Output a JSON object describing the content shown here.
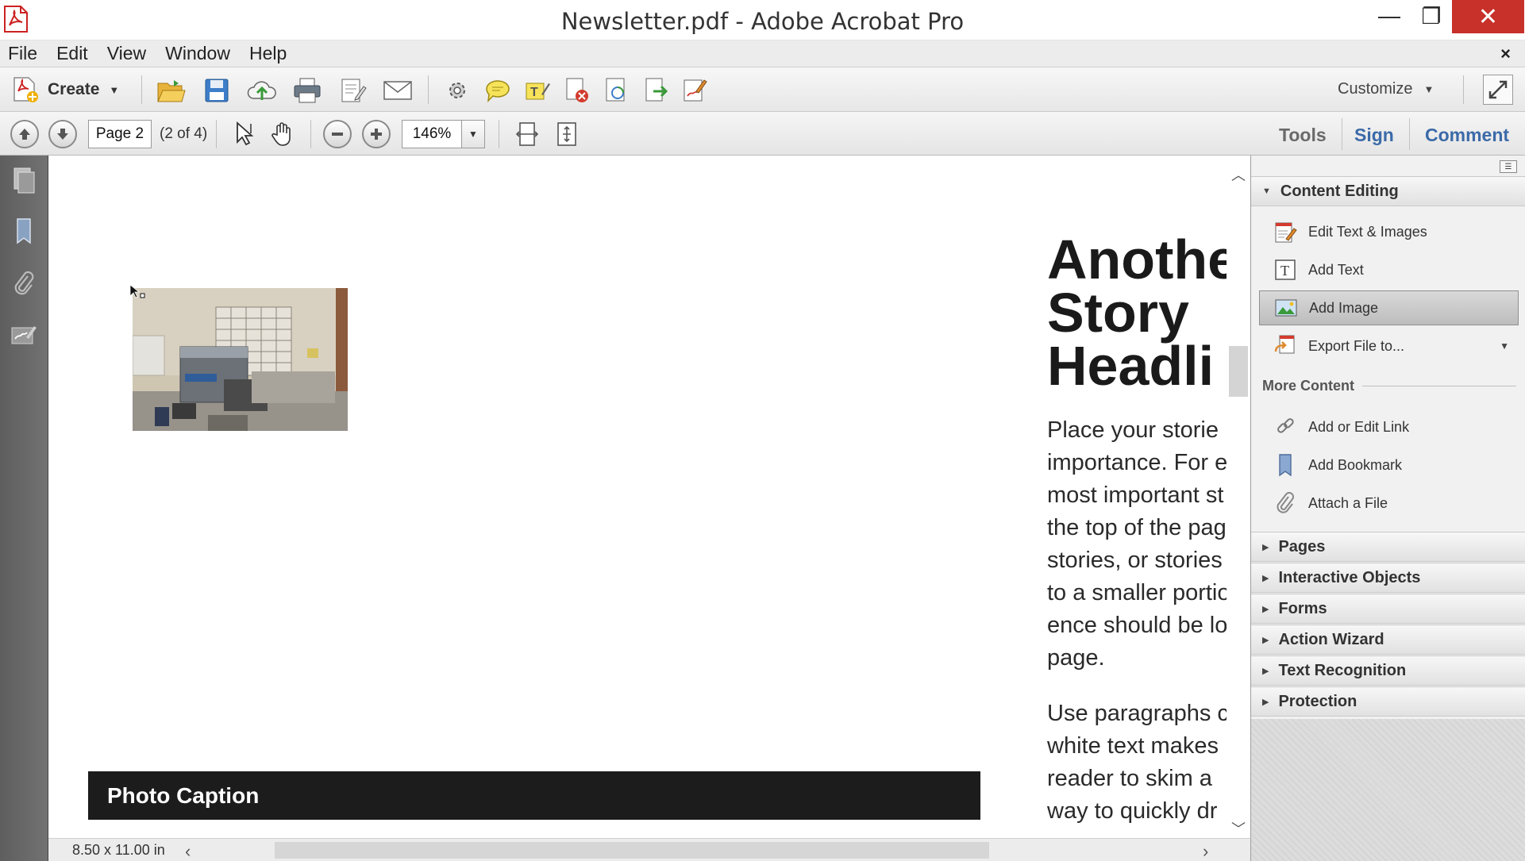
{
  "window": {
    "title": "Newsletter.pdf - Adobe Acrobat Pro",
    "minimize_glyph": "—",
    "maximize_glyph": "❐",
    "close_glyph": "✕"
  },
  "menu": {
    "items": [
      "File",
      "Edit",
      "View",
      "Window",
      "Help"
    ],
    "close_glyph": "×"
  },
  "toolbar": {
    "create_label": "Create",
    "customize_label": "Customize",
    "icons": [
      "open-folder-icon",
      "save-icon",
      "upload-cloud-icon",
      "print-icon",
      "edit-document-icon",
      "email-icon",
      "settings-gear-icon",
      "comment-bubble-icon",
      "highlight-text-icon",
      "delete-page-icon",
      "review-icon",
      "export-icon",
      "sign-document-icon"
    ]
  },
  "nav": {
    "page_value": "Page 2",
    "page_count": "(2 of 4)",
    "zoom_value": "146%"
  },
  "panes": {
    "tools": "Tools",
    "sign": "Sign",
    "comment": "Comment"
  },
  "document": {
    "headline": [
      "Anothe",
      "Story",
      "Headli"
    ],
    "paragraph1": [
      "Place your storie",
      "importance. For e",
      "most important st",
      "the top of the pag",
      "stories, or stories",
      "to a smaller portio",
      "ence should be lo",
      "page."
    ],
    "paragraph2": [
      "Use paragraphs c",
      "white text makes",
      "reader to skim a",
      "way to quickly dr"
    ],
    "caption": "Photo Caption",
    "page_size": "8.50 x 11.00 in"
  },
  "tools_pane": {
    "content_editing": "Content Editing",
    "items": [
      {
        "label": "Edit Text & Images",
        "icon": "edit-text-images-icon"
      },
      {
        "label": "Add Text",
        "icon": "add-text-icon"
      },
      {
        "label": "Add Image",
        "icon": "add-image-icon"
      },
      {
        "label": "Export File to...",
        "icon": "export-file-icon"
      }
    ],
    "more_content": "More Content",
    "more_items": [
      {
        "label": "Add or Edit Link",
        "icon": "link-icon"
      },
      {
        "label": "Add Bookmark",
        "icon": "bookmark-icon"
      },
      {
        "label": "Attach a File",
        "icon": "paperclip-icon"
      }
    ],
    "sections": [
      "Pages",
      "Interactive Objects",
      "Forms",
      "Action Wizard",
      "Text Recognition",
      "Protection"
    ]
  },
  "colors": {
    "close_button": "#c7312a",
    "pane_link": "#3b6aa8",
    "caption_bar": "#1c1c1c",
    "selected_tool": "#bdbdbd"
  }
}
